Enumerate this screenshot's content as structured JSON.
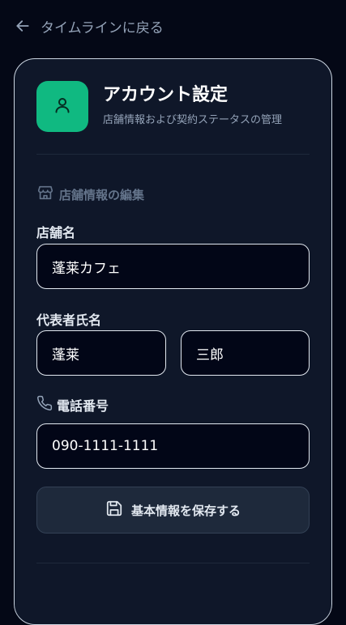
{
  "nav": {
    "back_label": "タイムラインに戻る",
    "back_icon": "arrow-left-icon"
  },
  "header": {
    "title": "アカウント設定",
    "subtitle": "店舗情報および契約ステータスの管理",
    "avatar_icon": "user-icon",
    "avatar_color": "#10b981"
  },
  "section": {
    "heading": "店舗情報の編集",
    "icon": "store-icon"
  },
  "form": {
    "store_name": {
      "label": "店舗名",
      "value": "蓬莱カフェ"
    },
    "representative": {
      "label": "代表者氏名",
      "last_name": "蓬莱",
      "first_name": "三郎"
    },
    "phone": {
      "label": "電話番号",
      "icon": "phone-icon",
      "value": "090-1111-1111"
    }
  },
  "actions": {
    "save_label": "基本情報を保存する",
    "save_icon": "save-icon"
  },
  "colors": {
    "background": "#040816",
    "card": "#0f1729",
    "accent": "#10b981",
    "muted_text": "#94a3b8"
  }
}
